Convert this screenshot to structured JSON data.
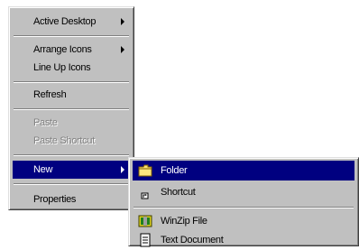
{
  "context_menu": {
    "items": [
      {
        "label": "Active Desktop",
        "enabled": true,
        "submenu": true
      },
      {
        "label": "Arrange Icons",
        "enabled": true,
        "submenu": true
      },
      {
        "label": "Line Up Icons",
        "enabled": true,
        "submenu": false
      },
      {
        "label": "Refresh",
        "enabled": true,
        "submenu": false
      },
      {
        "label": "Paste",
        "enabled": false,
        "submenu": false
      },
      {
        "label": "Paste Shortcut",
        "enabled": false,
        "submenu": false
      },
      {
        "label": "New",
        "enabled": true,
        "submenu": true,
        "selected": true
      },
      {
        "label": "Properties",
        "enabled": true,
        "submenu": false
      }
    ]
  },
  "new_submenu": {
    "items": [
      {
        "label": "Folder",
        "icon": "folder-icon",
        "selected": true
      },
      {
        "label": "Shortcut",
        "icon": "shortcut-icon"
      },
      {
        "label": "WinZip File",
        "icon": "winzip-icon"
      },
      {
        "label": "Text Document",
        "icon": "text-document-icon"
      }
    ]
  },
  "colors": {
    "menu_face": "#c0c0c0",
    "selection": "#000080",
    "disabled_text": "#808080"
  }
}
